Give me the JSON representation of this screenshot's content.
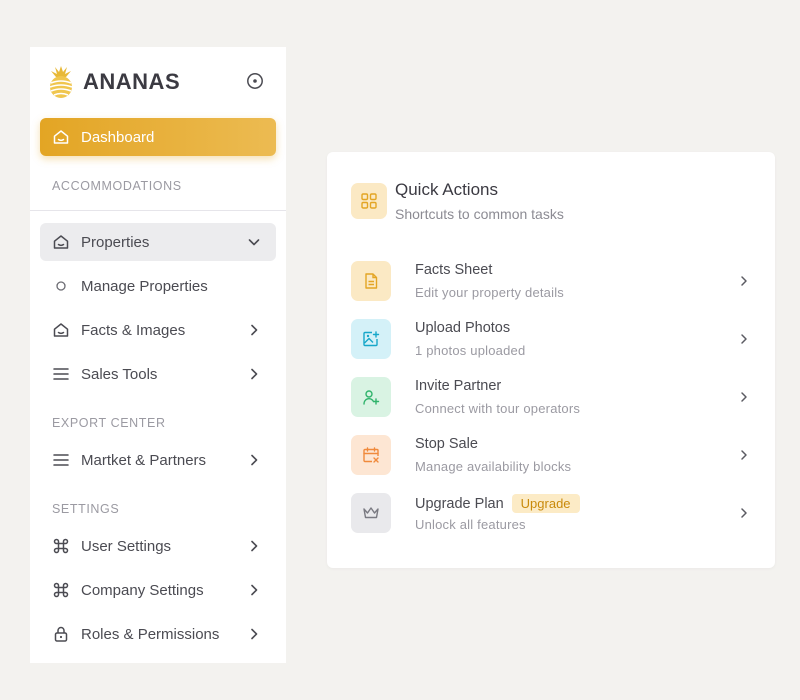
{
  "brand": {
    "name": "ANANAS",
    "logo_icon": "pineapple-logo",
    "accent": "#e3a524"
  },
  "sidebar": {
    "dashboard": {
      "label": "Dashboard",
      "icon": "home-icon"
    },
    "sections": {
      "accommodations": "ACCOMMODATIONS",
      "export_center": "EXPORT CENTER",
      "settings": "SETTINGS"
    },
    "items": {
      "properties": {
        "label": "Properties",
        "icon": "home-icon",
        "expanded": true
      },
      "manage_properties": {
        "label": "Manage Properties",
        "icon": "circle-icon"
      },
      "facts_images": {
        "label": "Facts & Images",
        "icon": "home-icon"
      },
      "sales_tools": {
        "label": "Sales Tools",
        "icon": "menu-icon"
      },
      "market_partners": {
        "label": "Martket & Partners",
        "icon": "menu-icon"
      },
      "user_settings": {
        "label": "User Settings",
        "icon": "command-icon"
      },
      "company_settings": {
        "label": "Company Settings",
        "icon": "command-icon"
      },
      "roles_permissions": {
        "label": "Roles & Permissions",
        "icon": "lock-icon"
      }
    }
  },
  "quick_actions": {
    "title": "Quick Actions",
    "subtitle": "Shortcuts to common tasks",
    "items": [
      {
        "title": "Facts Sheet",
        "desc": "Edit your property details",
        "icon": "document-icon",
        "color": "#e3a524",
        "bg": "#fbe9c4"
      },
      {
        "title": "Upload Photos",
        "desc": "1 photos uploaded",
        "icon": "image-plus-icon",
        "color": "#17a7c9",
        "bg": "#d4f1f8"
      },
      {
        "title": "Invite Partner",
        "desc": "Connect with tour operators",
        "icon": "user-plus-icon",
        "color": "#2fb36b",
        "bg": "#d9f3e3"
      },
      {
        "title": "Stop Sale",
        "desc": "Manage availability blocks",
        "icon": "calendar-x-icon",
        "color": "#f08a3c",
        "bg": "#fde6d3"
      },
      {
        "title": "Upgrade Plan",
        "desc": "Unlock all features",
        "icon": "crown-icon",
        "color": "#7a7a82",
        "bg": "#e9e9ec",
        "badge": "Upgrade"
      }
    ]
  }
}
